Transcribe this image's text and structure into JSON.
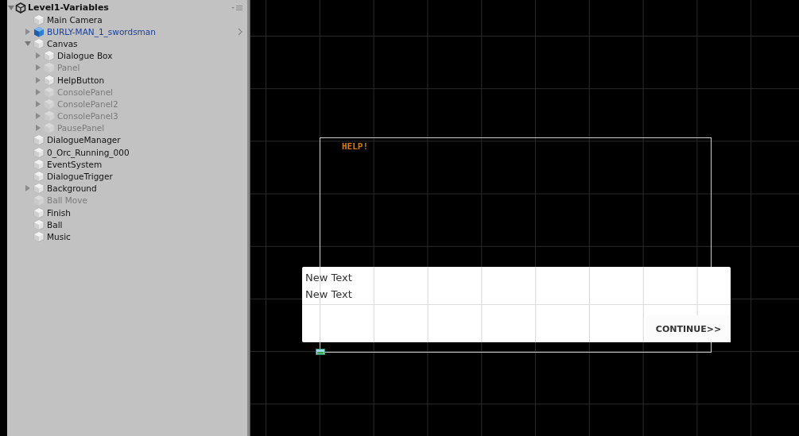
{
  "hierarchy": {
    "scene": {
      "title": "Level1-Variables",
      "expanded": true
    },
    "items": [
      {
        "name": "Main Camera",
        "kind": "object",
        "disabled": false,
        "foldable": false
      },
      {
        "name": "BURLY-MAN_1_swordsman",
        "kind": "prefab",
        "disabled": false,
        "foldable": true,
        "expanded": false
      },
      {
        "name": "Canvas",
        "kind": "object",
        "disabled": false,
        "foldable": true,
        "expanded": true,
        "children": [
          {
            "name": "Dialogue Box",
            "kind": "object",
            "disabled": false,
            "foldable": true,
            "expanded": false
          },
          {
            "name": "Panel",
            "kind": "object",
            "disabled": true,
            "foldable": true,
            "expanded": false
          },
          {
            "name": "HelpButton",
            "kind": "object",
            "disabled": false,
            "foldable": true,
            "expanded": false
          },
          {
            "name": "ConsolePanel",
            "kind": "object",
            "disabled": true,
            "foldable": true,
            "expanded": false
          },
          {
            "name": "ConsolePanel2",
            "kind": "object",
            "disabled": true,
            "foldable": true,
            "expanded": false
          },
          {
            "name": "ConsolePanel3",
            "kind": "object",
            "disabled": true,
            "foldable": true,
            "expanded": false
          },
          {
            "name": "PausePanel",
            "kind": "object",
            "disabled": true,
            "foldable": true,
            "expanded": false
          }
        ]
      },
      {
        "name": "DialogueManager",
        "kind": "object",
        "disabled": false,
        "foldable": false
      },
      {
        "name": "0_Orc_Running_000",
        "kind": "object",
        "disabled": false,
        "foldable": false
      },
      {
        "name": "EventSystem",
        "kind": "object",
        "disabled": false,
        "foldable": false
      },
      {
        "name": "DialogueTrigger",
        "kind": "object",
        "disabled": false,
        "foldable": false
      },
      {
        "name": "Background",
        "kind": "object",
        "disabled": false,
        "foldable": true,
        "expanded": false
      },
      {
        "name": "Ball Move",
        "kind": "object",
        "disabled": true,
        "foldable": false
      },
      {
        "name": "Finish",
        "kind": "object",
        "disabled": false,
        "foldable": false
      },
      {
        "name": "Ball",
        "kind": "object",
        "disabled": false,
        "foldable": false
      },
      {
        "name": "Music",
        "kind": "object",
        "disabled": false,
        "foldable": false
      }
    ]
  },
  "scene_view": {
    "help_label": "HELP!",
    "dialogue_box": {
      "lines": [
        "New Text",
        "New Text"
      ],
      "continue_button": "CONTINUE>>"
    }
  }
}
